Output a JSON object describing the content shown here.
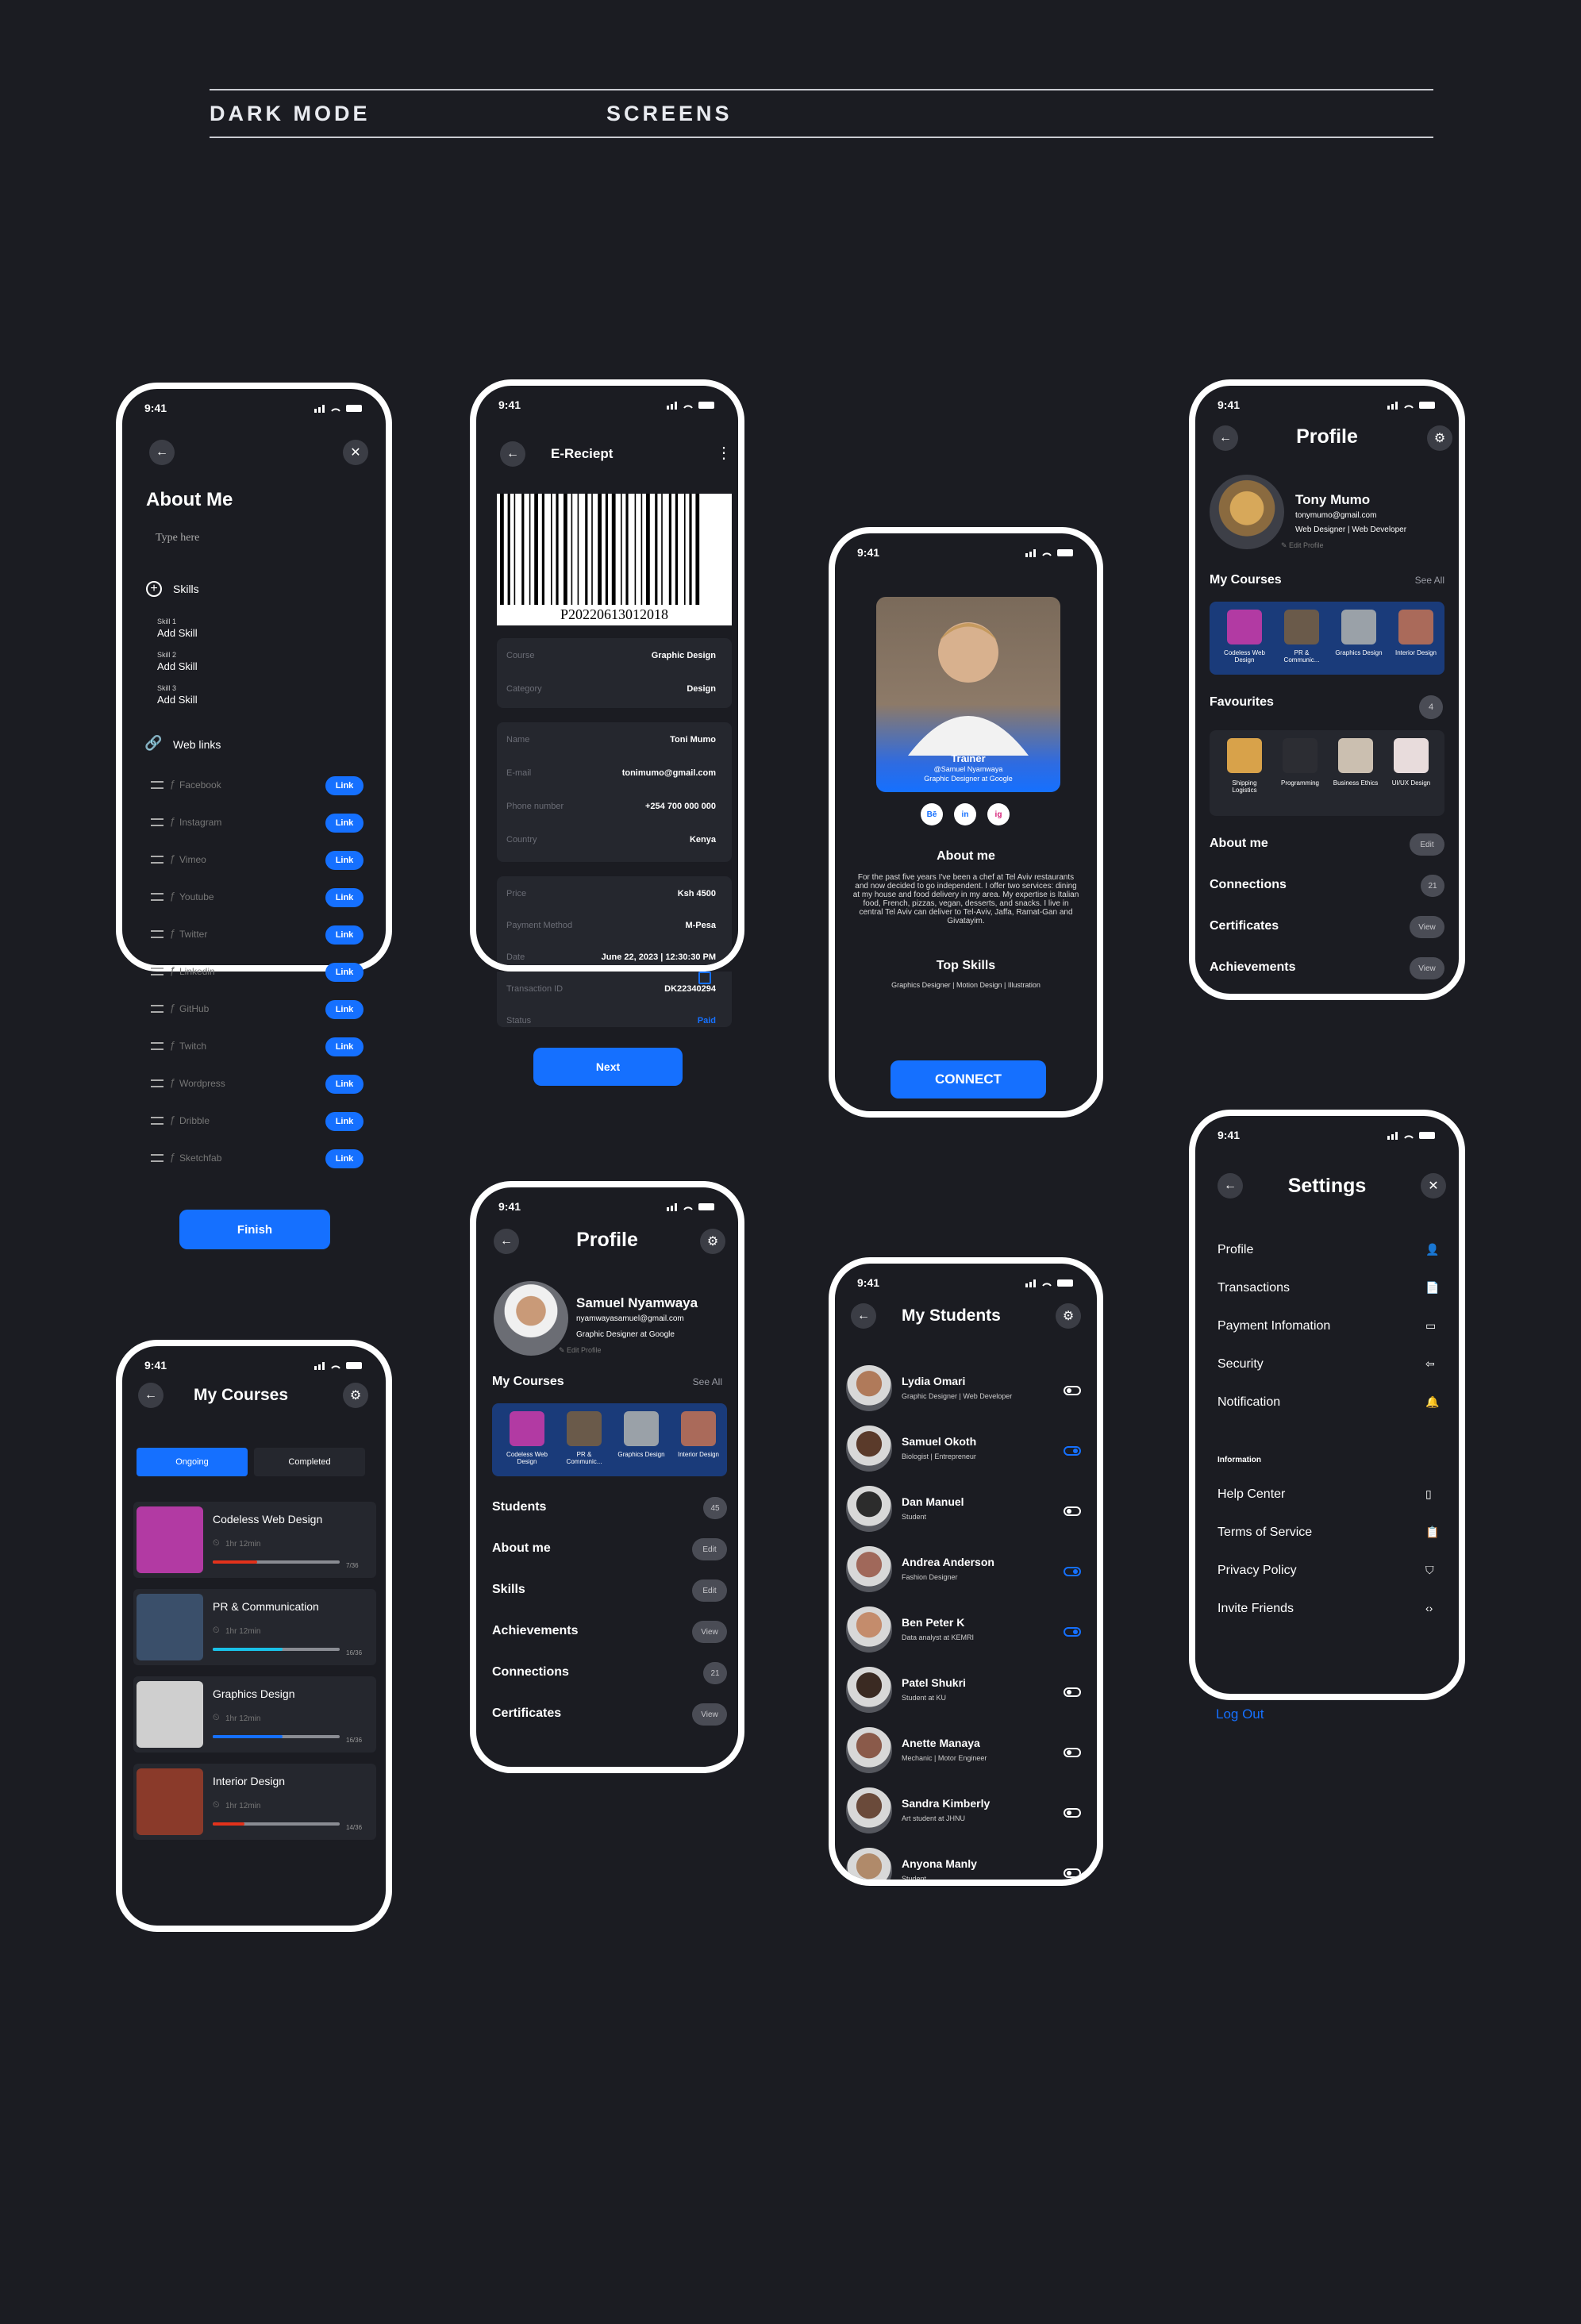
{
  "header": {
    "left": "DARK MODE",
    "right": "SCREENS"
  },
  "status_time": "9:41",
  "about": {
    "title": "About Me",
    "placeholder": "Type here",
    "skills_label": "Skills",
    "skills": [
      {
        "tag": "Skill 1",
        "value": "Add Skill"
      },
      {
        "tag": "Skill 2",
        "value": "Add Skill"
      },
      {
        "tag": "Skill 3",
        "value": "Add Skill"
      }
    ],
    "weblinks_label": "Web links",
    "links": [
      "Facebook",
      "Instagram",
      "Vimeo",
      "Youtube",
      "Twitter",
      "Linkedin",
      "GitHub",
      "Twitch",
      "Wordpress",
      "Dribble",
      "Sketchfab"
    ],
    "link_button": "Link",
    "finish": "Finish"
  },
  "receipt": {
    "title": "E-Reciept",
    "barcode": "P20220613012018",
    "course_rows": [
      {
        "label": "Course",
        "value": "Graphic Design"
      },
      {
        "label": "Category",
        "value": "Design"
      }
    ],
    "person_rows": [
      {
        "label": "Name",
        "value": "Toni Mumo"
      },
      {
        "label": "E-mail",
        "value": "tonimumo@gmail.com"
      },
      {
        "label": "Phone number",
        "value": "+254 700 000 000"
      },
      {
        "label": "Country",
        "value": "Kenya"
      }
    ],
    "pay_rows": [
      {
        "label": "Price",
        "value": "Ksh 4500"
      },
      {
        "label": "Payment Method",
        "value": "M-Pesa"
      },
      {
        "label": "Date",
        "value": "June 22, 2023 | 12:30:30 PM"
      },
      {
        "label": "Transaction ID",
        "value": "DK22340294"
      },
      {
        "label": "Status",
        "value": "Paid"
      }
    ],
    "next": "Next"
  },
  "trainer": {
    "badge": "Trainer",
    "handle": "@Samuel Nyamwaya",
    "role": "Graphic Designer at Google",
    "about_title": "About me",
    "about_text": "For the past five years I've been a chef at Tel Aviv restaurants and now decided to go independent. I offer two services: dining at my house and food delivery in my area. My expertise is Italian food, French, pizzas, vegan, desserts, and snacks. I live in central Tel Aviv can deliver to Tel-Aviv, Jaffa, Ramat-Gan and Givatayim.",
    "skills_title": "Top Skills",
    "skills_text": "Graphics Designer | Motion Design | Illustration",
    "connect": "CONNECT",
    "socials": [
      "Bē",
      "in",
      "ig"
    ]
  },
  "profile1": {
    "title": "Profile",
    "name": "Tony Mumo",
    "email": "tonymumo@gmail.com",
    "role": "Web Designer | Web Developer",
    "edit": "Edit Profile",
    "courses_label": "My Courses",
    "see_all": "See All",
    "courses": [
      "Codeless Web Design",
      "PR & Communic...",
      "Graphics Design",
      "Interior Design"
    ],
    "fav_label": "Favourites",
    "fav_count": "4",
    "favs": [
      "Shipping Logistics",
      "Programming",
      "Business Ethics",
      "UI/UX Design"
    ],
    "rows": [
      {
        "label": "About me",
        "action": "Edit"
      },
      {
        "label": "Connections",
        "action": "21"
      },
      {
        "label": "Certificates",
        "action": "View"
      },
      {
        "label": "Achievements",
        "action": "View"
      }
    ]
  },
  "settings": {
    "title": "Settings",
    "items": [
      "Profile",
      "Transactions",
      "Payment Infomation",
      "Security",
      "Notification"
    ],
    "info_label": "Information",
    "info_items": [
      "Help Center",
      "Terms of Service",
      "Privacy Policy",
      "Invite Friends"
    ],
    "logout": "Log Out"
  },
  "mycourses": {
    "title": "My Courses",
    "tabs": [
      "Ongoing",
      "Completed"
    ],
    "items": [
      {
        "name": "Codeless Web Design",
        "time": "1hr 12min",
        "count": "7/36",
        "progress": 0.35
      },
      {
        "name": "PR & Communication",
        "time": "1hr 12min",
        "count": "16/36",
        "progress": 0.55
      },
      {
        "name": "Graphics Design",
        "time": "1hr 12min",
        "count": "16/36",
        "progress": 0.55
      },
      {
        "name": "Interior Design",
        "time": "1hr 12min",
        "count": "14/36",
        "progress": 0.25
      }
    ]
  },
  "profile2": {
    "title": "Profile",
    "name": "Samuel Nyamwaya",
    "email": "nyamwayasamuel@gmail.com",
    "role": "Graphic Designer at Google",
    "edit": "Edit Profile",
    "courses_label": "My Courses",
    "see_all": "See All",
    "courses": [
      "Codeless Web Design",
      "PR & Communic...",
      "Graphics Design",
      "Interior Design"
    ],
    "rows": [
      {
        "label": "Students",
        "action": "45"
      },
      {
        "label": "About me",
        "action": "Edit"
      },
      {
        "label": "Skills",
        "action": "Edit"
      },
      {
        "label": "Achievements",
        "action": "View"
      },
      {
        "label": "Connections",
        "action": "21"
      },
      {
        "label": "Certificates",
        "action": "View"
      }
    ]
  },
  "students": {
    "title": "My Students",
    "items": [
      {
        "name": "Lydia Omari",
        "desc": "Graphic Designer | Web Developer",
        "on": false
      },
      {
        "name": "Samuel Okoth",
        "desc": "Biologist | Entrepreneur",
        "on": true
      },
      {
        "name": "Dan Manuel",
        "desc": "Student",
        "on": false
      },
      {
        "name": "Andrea Anderson",
        "desc": "Fashion Designer",
        "on": true
      },
      {
        "name": "Ben Peter K",
        "desc": "Data analyst at KEMRI",
        "on": true
      },
      {
        "name": "Patel Shukri",
        "desc": "Student at KU",
        "on": false
      },
      {
        "name": "Anette Manaya",
        "desc": "Mechanic | Motor Engineer",
        "on": false
      },
      {
        "name": "Sandra Kimberly",
        "desc": "Art student at JHNU",
        "on": false
      },
      {
        "name": "Anyona Manly",
        "desc": "Student",
        "on": false
      }
    ]
  },
  "colors": {
    "accent": "#1570ff",
    "bg": "#1b1c22",
    "card": "#25272e"
  }
}
